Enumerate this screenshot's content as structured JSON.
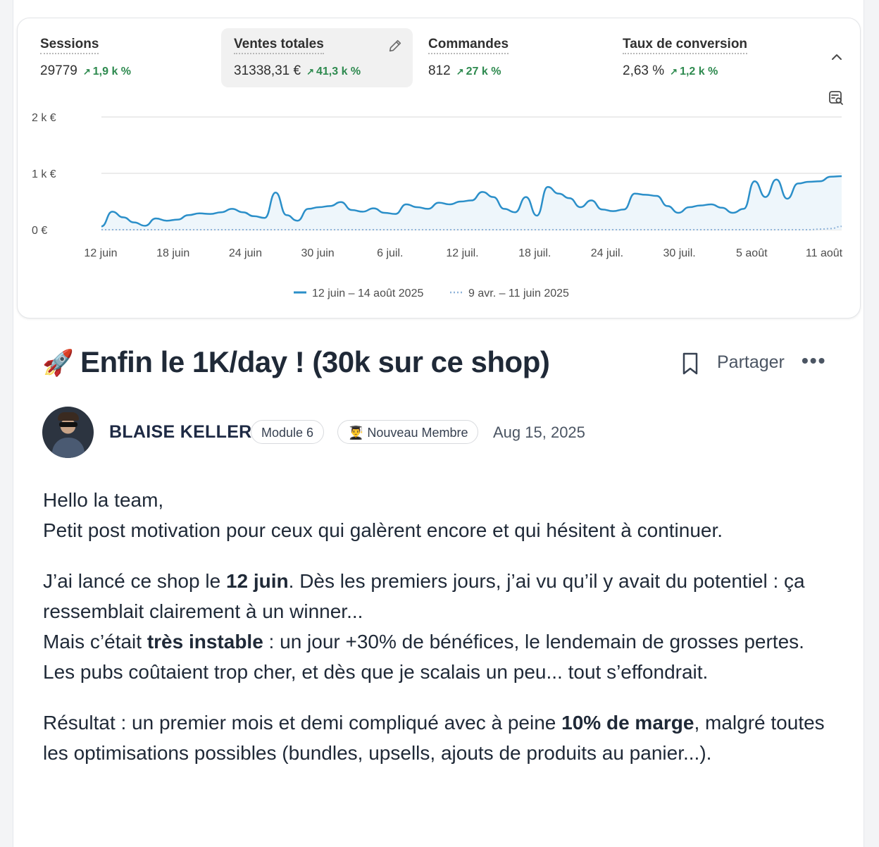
{
  "metrics": [
    {
      "label": "Sessions",
      "value": "29779",
      "delta": "1,9 k %"
    },
    {
      "label": "Ventes totales",
      "value": "31338,31 €",
      "delta": "41,3 k %"
    },
    {
      "label": "Commandes",
      "value": "812",
      "delta": "27 k %"
    },
    {
      "label": "Taux de conversion",
      "value": "2,63 %",
      "delta": "1,2 k %"
    }
  ],
  "chart_data": {
    "type": "line",
    "ylim": [
      0,
      2000
    ],
    "y_ticks": [
      "2 k €",
      "1 k €",
      "0 €"
    ],
    "x_ticks": [
      "12 juin",
      "18 juin",
      "24 juin",
      "30 juin",
      "6 juil.",
      "12 juil.",
      "18 juil.",
      "24 juil.",
      "30 juil.",
      "5 août",
      "11 août"
    ],
    "grid": true,
    "legend_position": "bottom",
    "series": [
      {
        "name": "12 juin – 14 août 2025",
        "style": "solid",
        "color": "#2b8fc9",
        "values": [
          60,
          320,
          220,
          130,
          70,
          200,
          160,
          180,
          260,
          290,
          280,
          310,
          370,
          310,
          240,
          210,
          660,
          260,
          160,
          370,
          400,
          420,
          490,
          350,
          320,
          380,
          300,
          280,
          450,
          400,
          370,
          480,
          450,
          500,
          520,
          670,
          580,
          370,
          310,
          580,
          250,
          760,
          640,
          560,
          400,
          520,
          360,
          330,
          360,
          640,
          620,
          600,
          420,
          300,
          400,
          430,
          450,
          390,
          300,
          370,
          860,
          580,
          890,
          550,
          820,
          850,
          860,
          940,
          950
        ]
      },
      {
        "name": "9 avr. – 11 juin 2025",
        "style": "dotted",
        "color": "#8fb4d9",
        "values": [
          0,
          0,
          0,
          0,
          0,
          0,
          0,
          0,
          0,
          0,
          0,
          0,
          0,
          0,
          0,
          0,
          0,
          0,
          0,
          0,
          0,
          0,
          0,
          0,
          0,
          0,
          0,
          0,
          0,
          0,
          0,
          0,
          0,
          0,
          0,
          0,
          0,
          0,
          0,
          0,
          0,
          0,
          0,
          0,
          0,
          0,
          0,
          0,
          0,
          0,
          0,
          0,
          0,
          0,
          0,
          0,
          0,
          0,
          0,
          0,
          0,
          0,
          0,
          0,
          0,
          0,
          10,
          20,
          60
        ]
      }
    ]
  },
  "post": {
    "emoji": "🚀",
    "title": "Enfin le 1K/day ! (30k sur ce shop)",
    "share_label": "Partager",
    "more_label": "•••",
    "author": "BLAISE KELLER",
    "badges": [
      "Module 6",
      "👨‍🎓 Nouveau Membre"
    ],
    "date": "Aug 15, 2025",
    "paragraphs": [
      [
        {
          "t": "Hello la team,"
        },
        {
          "br": true
        },
        {
          "t": "Petit post motivation pour ceux qui galèrent encore et qui hésitent à continuer."
        }
      ],
      [
        {
          "t": "J’ai lancé ce shop le "
        },
        {
          "t": "12 juin",
          "b": true
        },
        {
          "t": ". Dès les premiers jours, j’ai vu qu’il y avait du potentiel : ça ressemblait clairement à un winner..."
        },
        {
          "br": true
        },
        {
          "t": "Mais c’était "
        },
        {
          "t": "très instable",
          "b": true
        },
        {
          "t": " : un jour +30% de bénéfices, le lendemain de grosses pertes."
        },
        {
          "br": true
        },
        {
          "t": "Les pubs coûtaient trop cher, et dès que je scalais un peu... tout s’effondrait."
        }
      ],
      [
        {
          "t": "Résultat : un premier mois et demi compliqué avec à peine "
        },
        {
          "t": "10% de marge",
          "b": true
        },
        {
          "t": ", malgré toutes les optimisations possibles (bundles, upsells, ajouts de produits au panier...)."
        }
      ]
    ]
  }
}
